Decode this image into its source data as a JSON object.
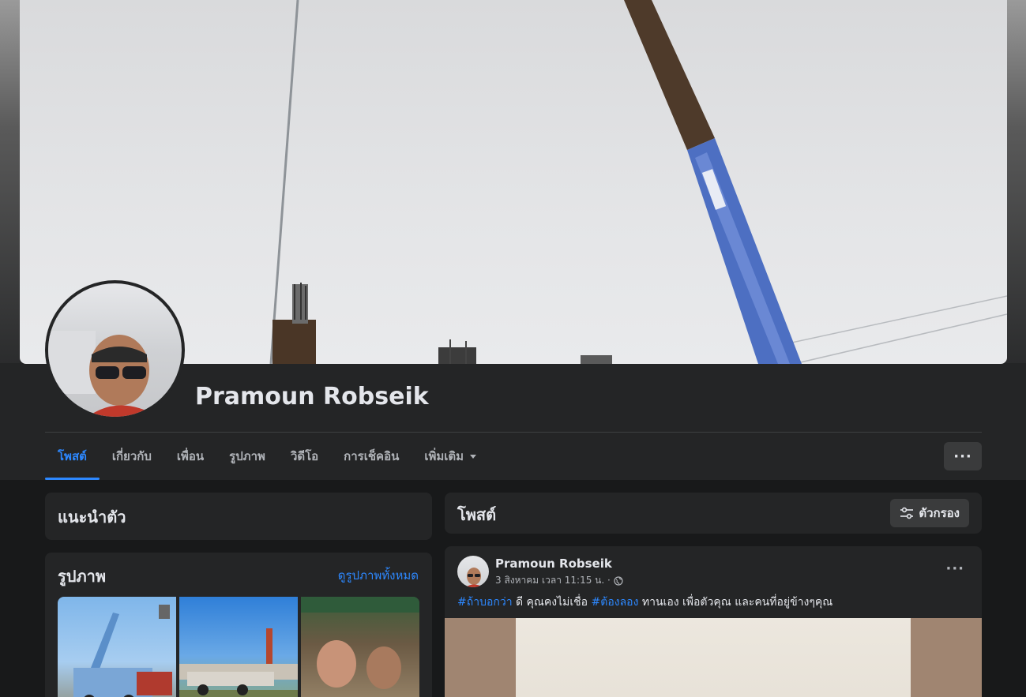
{
  "profile": {
    "name": "Pramoun Robseik"
  },
  "tabs": [
    {
      "label": "โพสต์",
      "active": true
    },
    {
      "label": "เกี่ยวกับ",
      "active": false
    },
    {
      "label": "เพื่อน",
      "active": false
    },
    {
      "label": "รูปภาพ",
      "active": false
    },
    {
      "label": "วิดีโอ",
      "active": false
    },
    {
      "label": "การเช็คอิน",
      "active": false
    },
    {
      "label": "เพิ่มเติม",
      "active": false
    }
  ],
  "more_button": {
    "label": "···"
  },
  "intro": {
    "title": "แนะนำตัว"
  },
  "photos": {
    "title": "รูปภาพ",
    "see_all": "ดูรูปภาพทั้งหมด"
  },
  "posts_header": {
    "title": "โพสต์",
    "filter_label": "ตัวกรอง"
  },
  "post": {
    "author": "Pramoun Robseik",
    "timestamp": "3 สิงหาคม เวลา 11:15 น. ·",
    "dots": "···",
    "hashtag1": "#ถ้าบอกว่า",
    "text1": " ดี  คุณคงไม่เชื่อ  ",
    "hashtag2": "#ต้องลอง",
    "text2": " ทานเอง  เพื่อตัวคุณ  และคนที่อยู่ข้างๆคุณ"
  },
  "colors": {
    "accent": "#2d88ff",
    "background": "#18191a",
    "card": "#242526"
  }
}
